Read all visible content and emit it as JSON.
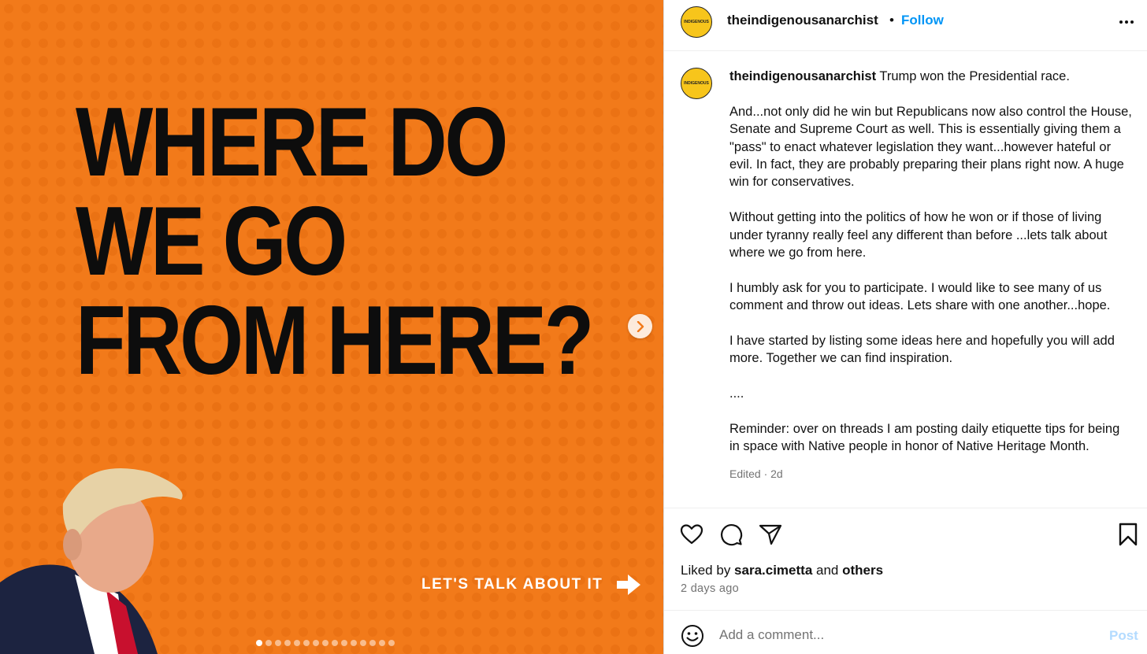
{
  "media": {
    "headline": [
      "WHERE DO",
      "WE GO",
      "FROM HERE?"
    ],
    "cta_label": "LET'S TALK ABOUT IT",
    "background_color": "#f27a1a",
    "slide_count": 15,
    "active_slide": 1
  },
  "post": {
    "username": "theindigenousanarchist",
    "separator": "•",
    "follow_label": "Follow",
    "avatar_text": "INDIGENOUS"
  },
  "caption": {
    "username": "theindigenousanarchist",
    "first_line": "Trump won the Presidential race.",
    "paragraphs": [
      "And...not only did he win but Republicans now also control the House, Senate and Supreme Court as well. This is essentially giving them a \"pass\" to enact whatever legislation they want...however hateful or evil. In fact, they are probably preparing their plans right now. A huge win for conservatives.",
      "Without getting into the politics of how he won or if those of living under tyranny really feel any different than before ...lets talk about where we go from here.",
      "I humbly ask for you to participate. I would like to see many of us comment and throw out ideas. Lets share with one another...hope.",
      "I have started by listing some ideas here and hopefully you will add more. Together we can find inspiration.",
      "....",
      "Reminder: over on threads I am posting daily etiquette tips for being in space with Native people in honor of Native Heritage Month."
    ],
    "meta": "Edited · 2d"
  },
  "engagement": {
    "liked_by_prefix": "Liked by ",
    "liked_by_user": "sara.cimetta",
    "liked_by_and": " and ",
    "liked_by_others": "others",
    "time_ago": "2 days ago"
  },
  "comment": {
    "placeholder": "Add a comment...",
    "post_label": "Post"
  },
  "colors": {
    "accent": "#0095f6",
    "post_disabled": "#b3dbff",
    "avatar_bg": "#f7c51b"
  }
}
